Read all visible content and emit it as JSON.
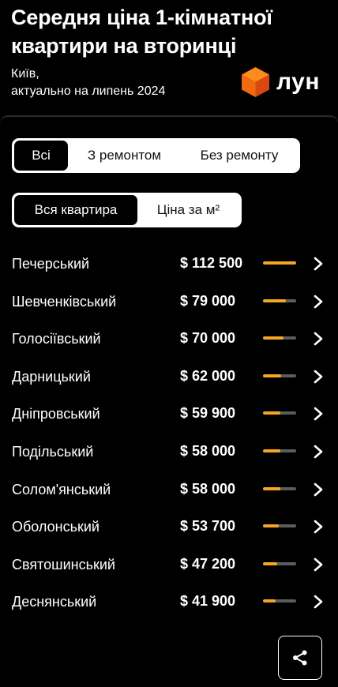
{
  "header": {
    "title": "Середня ціна 1-кімнатної квартири на вторинці",
    "city": "Київ,",
    "date_note": "актуально на липень 2024",
    "logo_text": "лун"
  },
  "filters": {
    "condition": [
      "Всі",
      "З ремонтом",
      "Без ремонту"
    ],
    "condition_active": "Всі",
    "price_type": [
      "Вся квартира",
      "Ціна за м²"
    ],
    "price_type_active": "Вся квартира"
  },
  "colors": {
    "accent": "#f5a623",
    "bar_track": "#5c5c5c"
  },
  "districts": [
    {
      "name": "Печерський",
      "price": "$ 112 500",
      "value": 112500
    },
    {
      "name": "Шевченківський",
      "price": "$ 79 000",
      "value": 79000
    },
    {
      "name": "Голосіївський",
      "price": "$ 70 000",
      "value": 70000
    },
    {
      "name": "Дарницький",
      "price": "$ 62 000",
      "value": 62000
    },
    {
      "name": "Дніпровський",
      "price": "$ 59 900",
      "value": 59900
    },
    {
      "name": "Подільський",
      "price": "$ 58 000",
      "value": 58000
    },
    {
      "name": "Солом'янський",
      "price": "$ 58 000",
      "value": 58000
    },
    {
      "name": "Оболонський",
      "price": "$ 53 700",
      "value": 53700
    },
    {
      "name": "Святошинський",
      "price": "$ 47 200",
      "value": 47200
    },
    {
      "name": "Деснянський",
      "price": "$ 41 900",
      "value": 41900
    }
  ],
  "icons": {
    "logo": "lun-cube-logo",
    "row_action": "chevron-right-icon",
    "share": "share-icon"
  }
}
